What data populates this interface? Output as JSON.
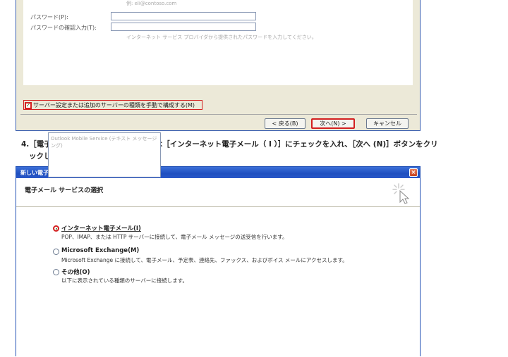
{
  "top_dialog": {
    "email_hint": "例: eli@contoso.com",
    "password_label": "パスワード(P):",
    "password_confirm_label": "パスワードの確認入力(T):",
    "password_hint": "インターネット サービス プロバイダから提供されたパスワードを入力してください。",
    "manual_config_label": "サーバー設定または追加のサーバーの種類を手動で構成する(M)",
    "buttons": {
      "back": "< 戻る(B)",
      "next": "次へ(N) >",
      "cancel": "キャンセル"
    }
  },
  "instruction": {
    "line1": "4.［電子メールサービスの選択」画面では［インターネット電子メール（ I ）］にチェックを入れ、［次へ (N)］ボタンをクリ",
    "line2": "ックします。"
  },
  "dialog2": {
    "title": "新しい電子メール アカウントの追加",
    "close_glyph": "×",
    "header_title": "電子メール サービスの選択",
    "options": [
      {
        "title": "インターネット電子メール(I)",
        "desc": "POP、IMAP、または HTTP サーバーに接続して、電子メール メッセージの送受信を行います。",
        "selected": true
      },
      {
        "title": "Microsoft Exchange(M)",
        "desc": "Microsoft Exchange に接続して、電子メール、予定表、連絡先、ファックス、およびボイス メールにアクセスします。",
        "selected": false
      },
      {
        "title": "その他(O)",
        "desc": "以下に表示されている種類のサーバーに接続します。",
        "selected": false
      }
    ],
    "other_list_items": [
      "Outlook Mobile Service (テキスト メッセージング)"
    ]
  },
  "colors": {
    "highlight": "#d32020",
    "titlebar": "#1f4fc0"
  },
  "icons": {
    "wizard": "cursor-sparkle-icon",
    "close": "close-icon"
  }
}
